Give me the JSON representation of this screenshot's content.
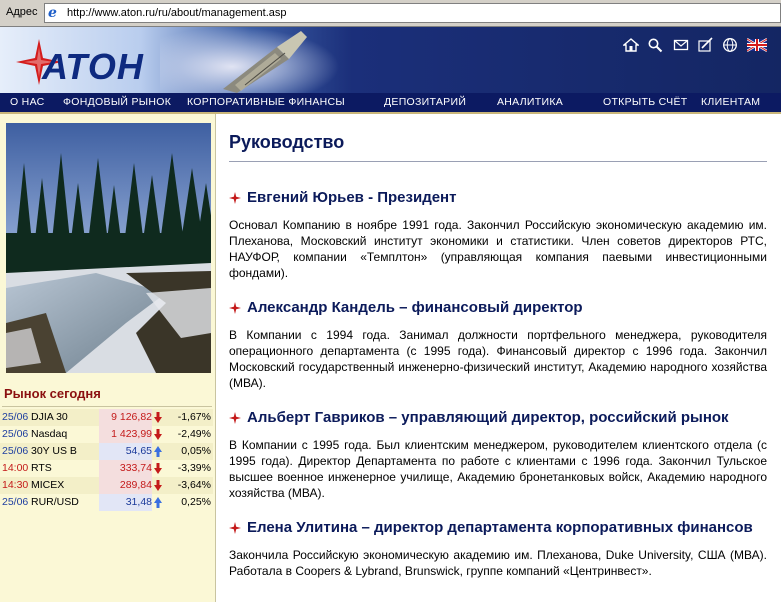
{
  "browser": {
    "address_label": "Адрес",
    "url": "http://www.aton.ru/ru/about/management.asp"
  },
  "brand": {
    "logo_text": "АТОН",
    "colors": {
      "navy": "#0c1a62",
      "red": "#c41a1a",
      "panel": "#fbf8d6"
    }
  },
  "header_icons": [
    "home-icon",
    "search-icon",
    "mail-icon",
    "feedback-icon",
    "globe-icon",
    "uk-flag-icon"
  ],
  "nav": {
    "items": [
      "О НАС",
      "ФОНДОВЫЙ РЫНОК",
      "КОРПОРАТИВНЫЕ ФИНАНСЫ",
      "ДЕПОЗИТАРИЙ",
      "АНАЛИТИКА",
      "ОТКРЫТЬ СЧЁТ",
      "КЛИЕНТАМ"
    ]
  },
  "market": {
    "title": "Рынок сегодня",
    "rows": [
      {
        "date": "25/06",
        "name": "DJIA 30",
        "value": "9 126,82",
        "direction": "down",
        "change": "-1,67%"
      },
      {
        "date": "25/06",
        "name": "Nasdaq",
        "value": "1 423,99",
        "direction": "down",
        "change": "-2,49%"
      },
      {
        "date": "25/06",
        "name": "30Y US B",
        "value": "54,65",
        "direction": "up",
        "change": "0,05%"
      },
      {
        "date": "14:00",
        "name": "RTS",
        "value": "333,74",
        "direction": "down",
        "change": "-3,39%"
      },
      {
        "date": "14:30",
        "name": "MICEX",
        "value": "289,84",
        "direction": "down",
        "change": "-3,64%"
      },
      {
        "date": "25/06",
        "name": "RUR/USD",
        "value": "31,48",
        "direction": "up",
        "change": "0,25%"
      }
    ]
  },
  "content": {
    "title": "Руководство",
    "people": [
      {
        "name": "Евгений Юрьев - Президент",
        "bio": "Основал Компанию в ноябре 1991 года. Закончил Российскую экономическую академию им. Плеханова, Московский институт экономики и статистики. Член советов директоров РТС, НАУФОР, компании «Темплтон» (управляющая компания паевыми инвестиционными фондами)."
      },
      {
        "name": "Александр Кандель – финансовый директор",
        "bio": "В Компании с 1994 года. Занимал должности портфельного менеджера, руководителя операционного департамента (с 1995 года). Финансовый директор с 1996 года. Закончил Московский государственный инженерно-физический институт, Академию народного хозяйства (МВА)."
      },
      {
        "name": "Альберт Гавриков – управляющий директор, российский рынок",
        "bio": "В Компании с 1995 года. Был клиентским менеджером, руководителем клиентского отдела (с 1995 года). Директор Департамента по работе с клиентами с 1996 года. Закончил Тульское высшее военное инженерное училище, Академию бронетанковых войск, Академию народного хозяйства (МВА)."
      },
      {
        "name": "Елена Улитина – директор департамента корпоративных финансов",
        "bio": "Закончила Российскую экономическую академию им. Плеханова, Duke University, США (МВА). Работала в Coopers & Lybrand, Brunswick, группе компаний «Центринвест»."
      }
    ]
  }
}
